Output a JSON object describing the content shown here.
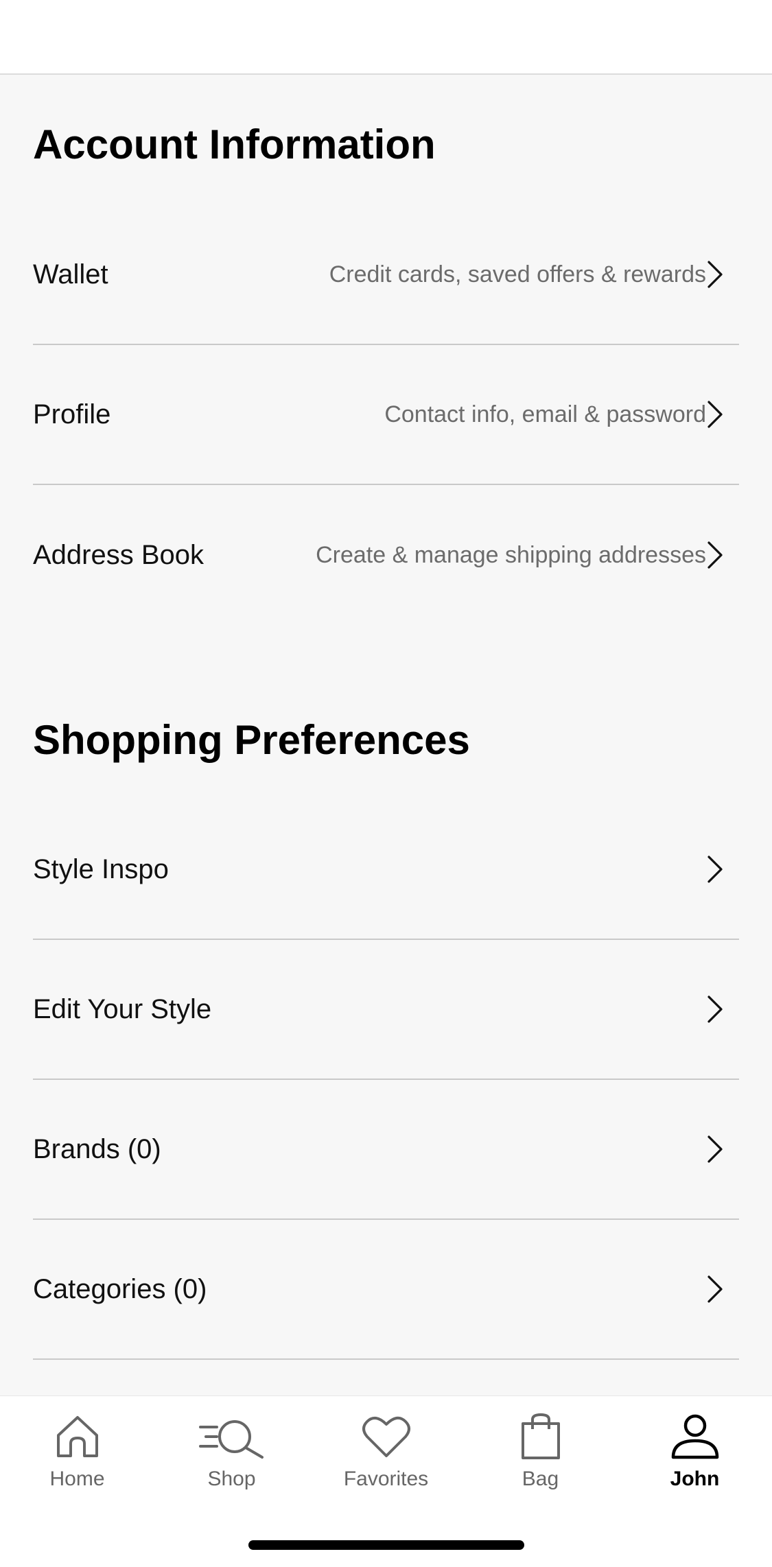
{
  "account": {
    "title": "Account Information",
    "items": [
      {
        "label": "Wallet",
        "description": "Credit cards, saved offers & rewards"
      },
      {
        "label": "Profile",
        "description": "Contact info, email & password"
      },
      {
        "label": "Address Book",
        "description": "Create & manage shipping addresses"
      }
    ]
  },
  "preferences": {
    "title": "Shopping Preferences",
    "items": [
      {
        "label": "Style Inspo"
      },
      {
        "label": "Edit Your Style"
      },
      {
        "label": "Brands (0)"
      },
      {
        "label": "Categories (0)"
      }
    ]
  },
  "tabbar": {
    "tabs": [
      {
        "label": "Home",
        "icon": "home-icon"
      },
      {
        "label": "Shop",
        "icon": "shop-search-icon"
      },
      {
        "label": "Favorites",
        "icon": "heart-icon"
      },
      {
        "label": "Bag",
        "icon": "bag-icon"
      },
      {
        "label": "John",
        "icon": "person-icon"
      }
    ],
    "active": "John"
  },
  "colors": {
    "background": "#f7f7f7",
    "text": "#111111",
    "secondary_text": "#6b6b6b",
    "divider": "#c9c9c9"
  }
}
